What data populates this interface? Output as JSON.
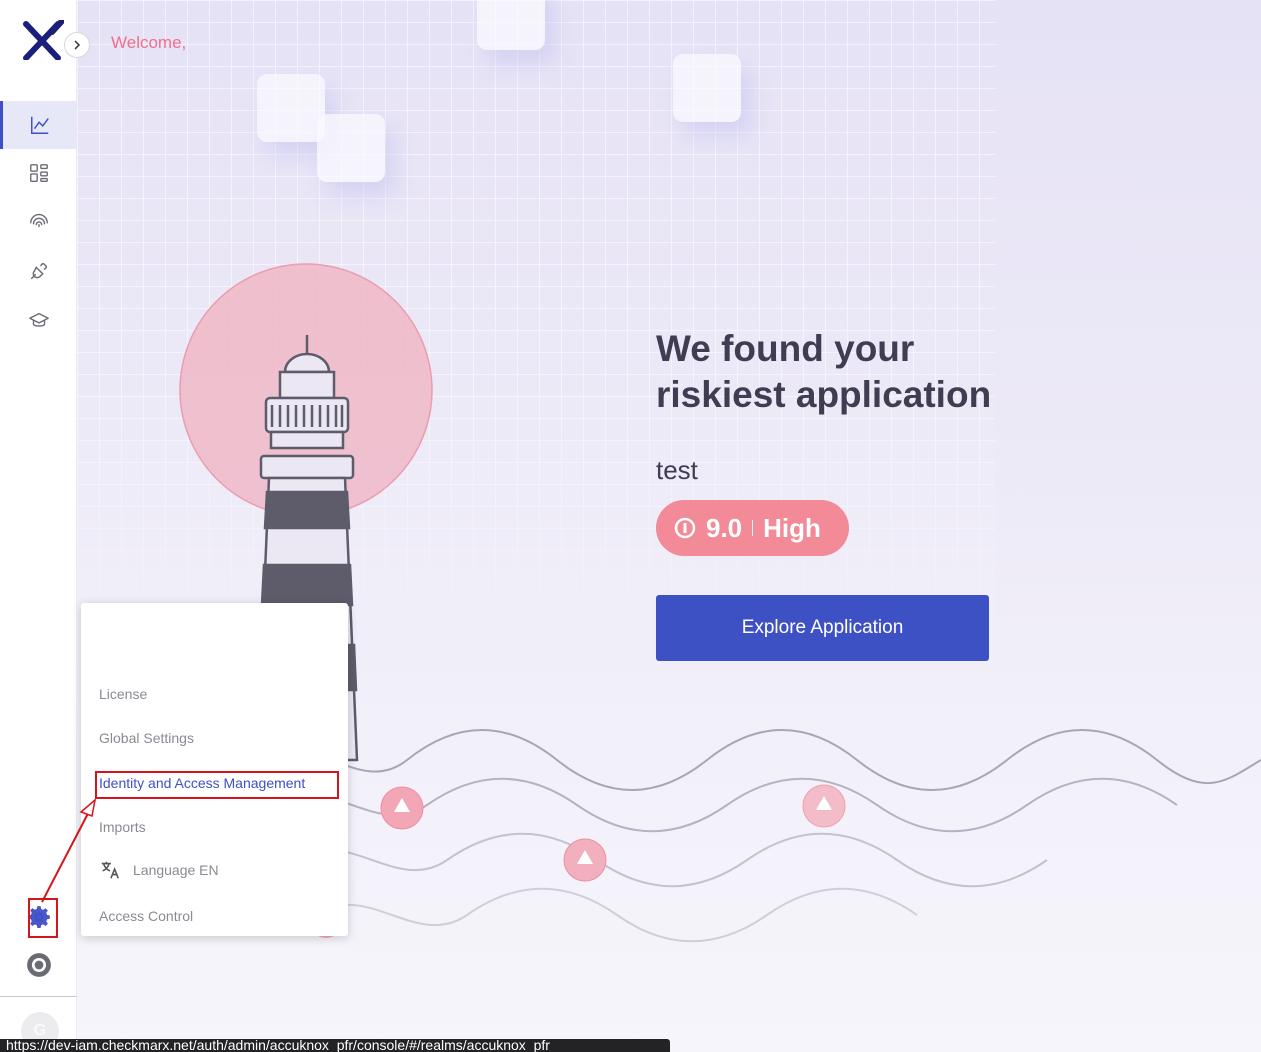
{
  "header": {
    "welcome": "Welcome,"
  },
  "sidebar": {
    "items": [
      {
        "icon": "chart-line-icon",
        "label": "Dashboard",
        "active": true
      },
      {
        "icon": "dashboard-grid-icon",
        "label": "Applications",
        "active": false
      },
      {
        "icon": "fingerprint-icon",
        "label": "Scans",
        "active": false
      },
      {
        "icon": "plug-icon",
        "label": "Integrations",
        "active": false
      },
      {
        "icon": "graduation-cap-icon",
        "label": "Learning",
        "active": false
      }
    ],
    "bottom": [
      {
        "icon": "gear-icon",
        "label": "Settings",
        "active": true
      },
      {
        "icon": "help-icon",
        "label": "Help",
        "active": false
      }
    ],
    "avatar_initial": "G"
  },
  "hero": {
    "title": "We found your riskiest application",
    "app_name": "test",
    "risk_score": "9.0",
    "risk_level": "High",
    "risk_color": "#f28a98",
    "explore_label": "Explore Application",
    "accent_color": "#3e51c4"
  },
  "settings_menu": {
    "items": [
      {
        "label": "License"
      },
      {
        "label": "Global Settings"
      },
      {
        "label": "Identity and Access Management",
        "highlighted": true
      },
      {
        "label": "Imports"
      },
      {
        "label": "Language EN",
        "icon": "translate-icon"
      },
      {
        "label": "Access Control"
      }
    ]
  },
  "status_bar": {
    "url": "https://dev-iam.checkmarx.net/auth/admin/accuknox_pfr/console/#/realms/accuknox_pfr"
  }
}
